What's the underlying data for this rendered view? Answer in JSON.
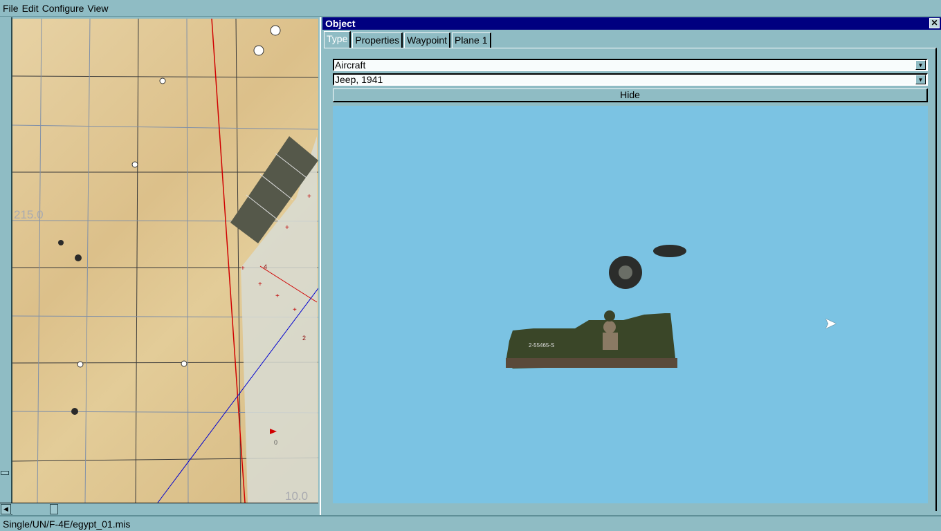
{
  "menu": [
    "File",
    "Edit",
    "Configure",
    "View"
  ],
  "map": {
    "labels": [
      "215.0",
      "10.0"
    ],
    "waypoint_labels": [
      "4",
      "2",
      "0"
    ]
  },
  "status": {
    "path": "Single/UN/F-4E/egypt_01.mis"
  },
  "object_panel": {
    "title": "Object",
    "tabs": [
      "Type",
      "Properties",
      "Waypoint",
      "Plane 1"
    ],
    "active_tab": "Type",
    "category": "Aircraft",
    "object_type": "Jeep, 1941",
    "hide_label": "Hide",
    "jeep_number": "2-55465-S"
  },
  "colors": {
    "bg": "#8fbcc4",
    "title": "#000080",
    "preview": "#7bc3e3"
  }
}
